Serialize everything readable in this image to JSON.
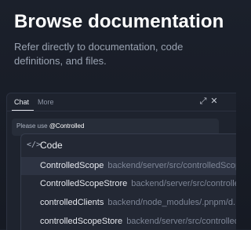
{
  "hero": {
    "title": "Browse documentation",
    "subtitle": "Refer directly to documentation, code definitions, and files."
  },
  "panel": {
    "tabs": [
      {
        "label": "Chat",
        "active": true
      },
      {
        "label": "More",
        "active": false
      }
    ],
    "window_buttons": {
      "expand_glyph": "⤢",
      "close_glyph": "✕"
    },
    "input": {
      "prefix": "Please use ",
      "mention": "@Controlled"
    }
  },
  "dropdown": {
    "icon": "code-brackets-icon",
    "icon_glyph": "</>",
    "title": "Code",
    "items": [
      {
        "name": "ControlledScope",
        "path": "backend/server/src/controlledScope.ts",
        "selected": true
      },
      {
        "name": "ControlledScopeStrore",
        "path": "backend/server/src/controlledScope.ts",
        "selected": false
      },
      {
        "name": "controlledClients",
        "path": "backend/node_modules/.pnpm/d...",
        "selected": false
      },
      {
        "name": "controlledScopeStore",
        "path": "backend/server/src/controlled...",
        "selected": false
      }
    ]
  },
  "colors": {
    "background": "#1b202b",
    "panel": "#1e232e",
    "dropdown": "#232834",
    "selected_row": "#2d3342"
  }
}
